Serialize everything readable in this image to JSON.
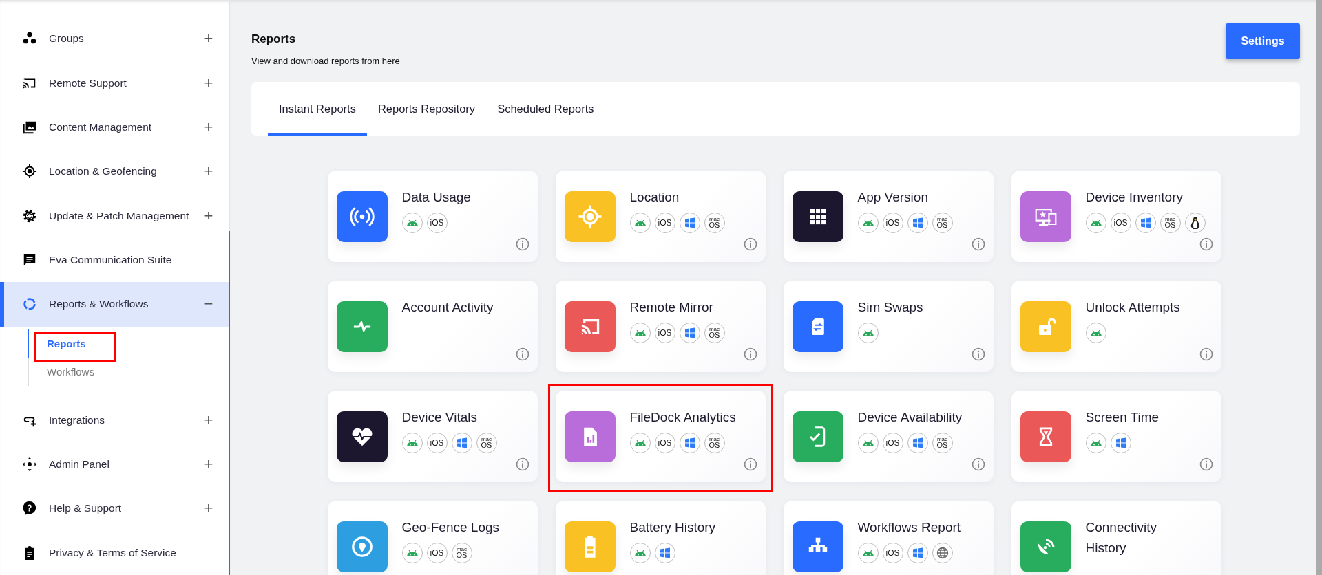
{
  "sidebar": {
    "items": [
      {
        "kind": "groups",
        "label": "Groups",
        "toggle": "+",
        "selected": false
      },
      {
        "kind": "cast",
        "label": "Remote Support",
        "toggle": "+",
        "selected": false
      },
      {
        "kind": "gallery",
        "label": "Content Management",
        "toggle": "+",
        "selected": false
      },
      {
        "kind": "target",
        "label": "Location & Geofencing",
        "toggle": "+",
        "selected": false
      },
      {
        "kind": "gear",
        "label": "Update & Patch Management",
        "toggle": "+",
        "selected": false
      },
      {
        "kind": "chat",
        "label": "Eva Communication Suite",
        "selected": false
      },
      {
        "kind": "donut",
        "label": "Reports & Workflows",
        "toggle": "−",
        "selected": true,
        "children": [
          {
            "label": "Reports",
            "selected": true,
            "highlighted": true
          },
          {
            "label": "Workflows",
            "selected": false,
            "highlighted": false
          }
        ]
      },
      {
        "kind": "link",
        "label": "Integrations",
        "toggle": "+",
        "selected": false
      },
      {
        "kind": "move",
        "label": "Admin Panel",
        "toggle": "+",
        "selected": false
      },
      {
        "kind": "help",
        "label": "Help & Support",
        "toggle": "+",
        "selected": false
      },
      {
        "kind": "clipboard",
        "label": "Privacy & Terms of Service",
        "selected": false
      }
    ]
  },
  "header": {
    "title": "Reports",
    "subtitle": "View and download reports from here",
    "settings_button": "Settings"
  },
  "tabs": [
    {
      "label": "Instant Reports",
      "selected": true
    },
    {
      "label": "Reports Repository",
      "selected": false
    },
    {
      "label": "Scheduled Reports",
      "selected": false
    }
  ],
  "cards": [
    {
      "title": "Data Usage",
      "kind": "signal",
      "color": "#2a6bff",
      "info": true,
      "highlighted": false,
      "platforms": [
        {
          "kind": "android"
        },
        {
          "kind": "ios",
          "label": "iOS"
        }
      ]
    },
    {
      "title": "Location",
      "kind": "target",
      "color": "#f9c124",
      "info": true,
      "highlighted": false,
      "platforms": [
        {
          "kind": "android"
        },
        {
          "kind": "ios",
          "label": "iOS"
        },
        {
          "kind": "windows"
        },
        {
          "kind": "macos",
          "label_top": "mac",
          "label": "OS"
        }
      ]
    },
    {
      "title": "App Version",
      "kind": "grid",
      "color": "#1c162e",
      "info": true,
      "highlighted": false,
      "platforms": [
        {
          "kind": "android"
        },
        {
          "kind": "ios",
          "label": "iOS"
        },
        {
          "kind": "windows"
        },
        {
          "kind": "macos",
          "label_top": "mac",
          "label": "OS"
        }
      ]
    },
    {
      "title": "Device Inventory",
      "kind": "devices",
      "color": "#b96ddb",
      "info": true,
      "highlighted": false,
      "platforms": [
        {
          "kind": "android"
        },
        {
          "kind": "ios",
          "label": "iOS"
        },
        {
          "kind": "windows"
        },
        {
          "kind": "macos",
          "label_top": "mac",
          "label": "OS"
        },
        {
          "kind": "linux"
        }
      ]
    },
    {
      "title": "Account Activity",
      "kind": "pulse",
      "color": "#28ad5e",
      "info": true,
      "highlighted": false
    },
    {
      "title": "Remote Mirror",
      "kind": "cast",
      "color": "#ea5858",
      "info": true,
      "highlighted": false,
      "platforms": [
        {
          "kind": "android"
        },
        {
          "kind": "ios",
          "label": "iOS"
        },
        {
          "kind": "windows"
        },
        {
          "kind": "macos",
          "label_top": "mac",
          "label": "OS"
        }
      ]
    },
    {
      "title": "Sim Swaps",
      "kind": "sim",
      "color": "#2a6bff",
      "info": true,
      "highlighted": false,
      "platforms": [
        {
          "kind": "android"
        }
      ]
    },
    {
      "title": "Unlock Attempts",
      "kind": "unlock",
      "color": "#f9c124",
      "info": true,
      "highlighted": false,
      "platforms": [
        {
          "kind": "android"
        }
      ]
    },
    {
      "title": "Device Vitals",
      "kind": "heart",
      "color": "#1c162e",
      "info": true,
      "highlighted": false,
      "platforms": [
        {
          "kind": "android"
        },
        {
          "kind": "ios",
          "label": "iOS"
        },
        {
          "kind": "windows"
        },
        {
          "kind": "macos",
          "label_top": "mac",
          "label": "OS"
        }
      ]
    },
    {
      "title": "FileDock Analytics",
      "kind": "filechart",
      "color": "#b96ddb",
      "info": true,
      "highlighted": true,
      "platforms": [
        {
          "kind": "android"
        },
        {
          "kind": "ios",
          "label": "iOS"
        },
        {
          "kind": "windows"
        },
        {
          "kind": "macos",
          "label_top": "mac",
          "label": "OS"
        }
      ]
    },
    {
      "title": "Device Availability",
      "kind": "phonecheck",
      "color": "#28ad5e",
      "info": true,
      "highlighted": false,
      "platforms": [
        {
          "kind": "android"
        },
        {
          "kind": "ios",
          "label": "iOS"
        },
        {
          "kind": "windows"
        },
        {
          "kind": "macos",
          "label_top": "mac",
          "label": "OS"
        }
      ]
    },
    {
      "title": "Screen Time",
      "kind": "hourglass",
      "color": "#ea5858",
      "info": true,
      "highlighted": false,
      "platforms": [
        {
          "kind": "android"
        },
        {
          "kind": "windows"
        }
      ]
    },
    {
      "title": "Geo-Fence Logs",
      "kind": "pin",
      "color": "#2d9fe0",
      "info": false,
      "highlighted": false,
      "platforms": [
        {
          "kind": "android"
        },
        {
          "kind": "ios",
          "label": "iOS"
        },
        {
          "kind": "macos",
          "label_top": "mac",
          "label": "OS"
        }
      ]
    },
    {
      "title": "Battery History",
      "kind": "battery",
      "color": "#f9c124",
      "info": false,
      "highlighted": false,
      "platforms": [
        {
          "kind": "android"
        },
        {
          "kind": "windows"
        }
      ]
    },
    {
      "title": "Workflows Report",
      "kind": "hierarchy",
      "color": "#2a6bff",
      "info": false,
      "highlighted": false,
      "platforms": [
        {
          "kind": "android"
        },
        {
          "kind": "ios",
          "label": "iOS"
        },
        {
          "kind": "windows"
        },
        {
          "kind": "web"
        }
      ]
    },
    {
      "title": "Connectivity History",
      "kind": "dish",
      "color": "#28ad5e",
      "info": false,
      "highlighted": false
    }
  ]
}
